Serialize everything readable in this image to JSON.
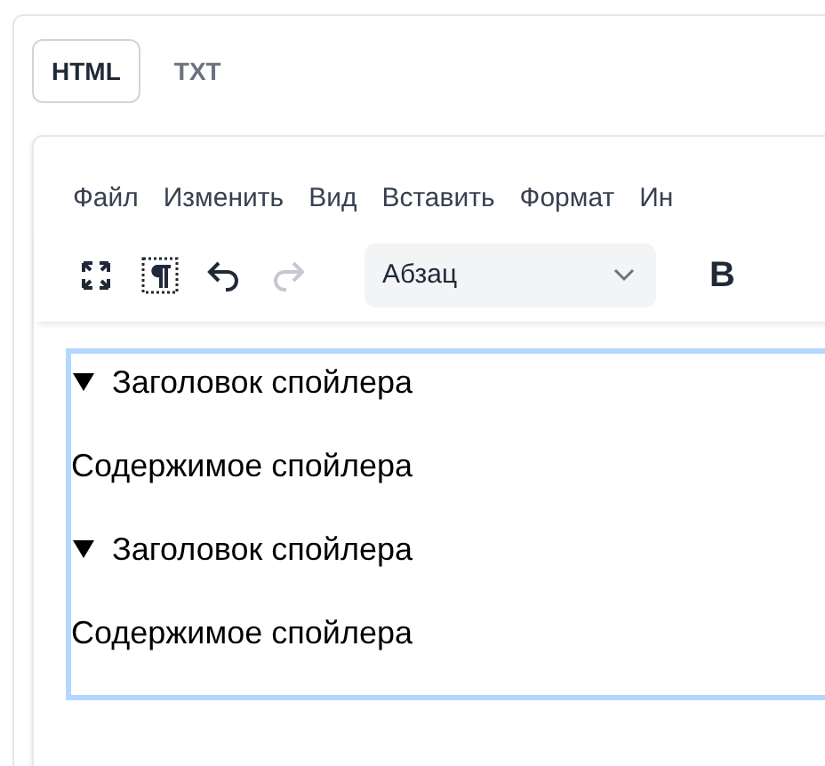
{
  "tabs": [
    {
      "label": "HTML",
      "selected": true
    },
    {
      "label": "TXT",
      "selected": false
    }
  ],
  "menu": [
    "Файл",
    "Изменить",
    "Вид",
    "Вставить",
    "Формат",
    "Ин"
  ],
  "toolbar": {
    "undo_disabled": false,
    "redo_disabled": true,
    "block_format": "Абзац",
    "bold_label": "B"
  },
  "content": [
    {
      "kind": "spoiler",
      "summary": "Заголовок спойлера",
      "expanded": true,
      "body": "Содержимое спойлера"
    },
    {
      "kind": "spoiler",
      "summary": "Заголовок спойлера",
      "expanded": true,
      "body": "Содержимое спойлера"
    }
  ]
}
